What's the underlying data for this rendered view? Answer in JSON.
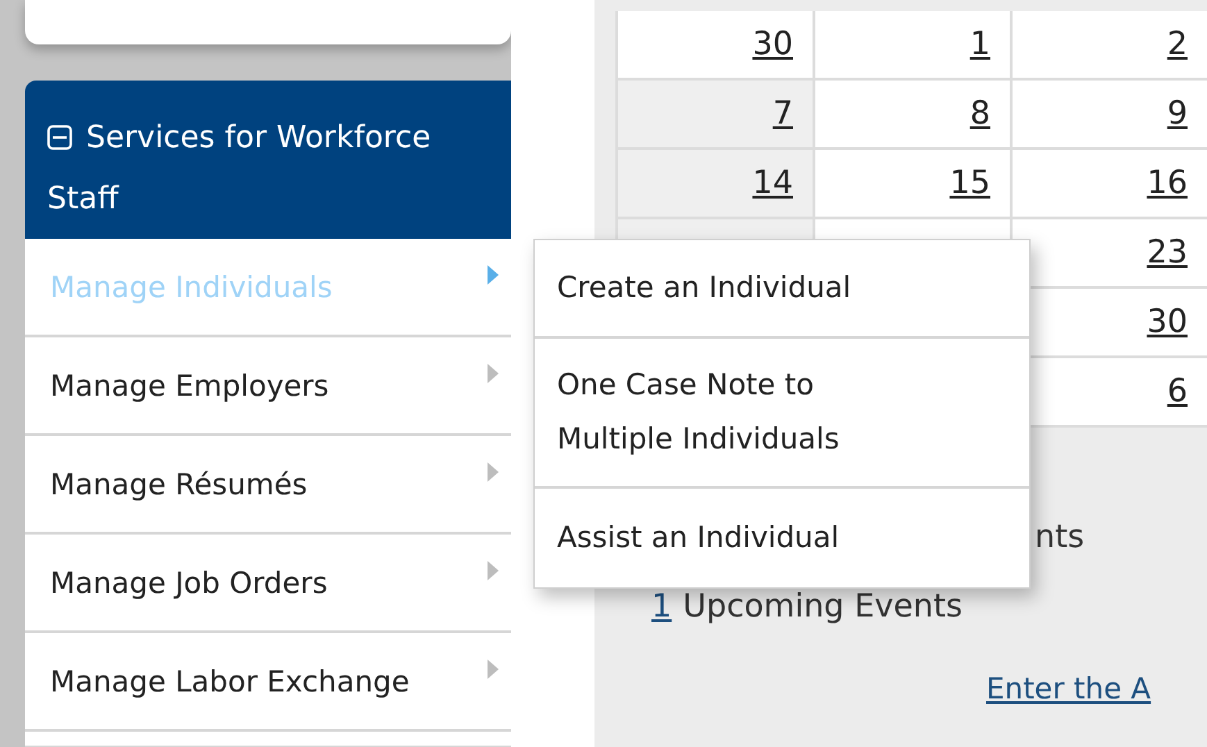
{
  "sidebar": {
    "header": {
      "label": "Services for Workforce Staff",
      "expanded": true
    },
    "items": [
      {
        "label": "Manage Individuals",
        "selected": true
      },
      {
        "label": "Manage Employers",
        "selected": false
      },
      {
        "label": "Manage Résumés",
        "selected": false
      },
      {
        "label": "Manage Job Orders",
        "selected": false
      },
      {
        "label": "Manage Labor Exchange",
        "selected": false
      }
    ]
  },
  "submenu": {
    "items": [
      "Create an Individual",
      "One Case Note to Multiple Individuals",
      "Assist an Individual"
    ]
  },
  "calendar": {
    "rows": [
      [
        "30",
        "1",
        "2"
      ],
      [
        "7",
        "8",
        "9"
      ],
      [
        "14",
        "15",
        "16"
      ],
      [
        "",
        "",
        "23"
      ],
      [
        "",
        "",
        "30"
      ],
      [
        "",
        "",
        "6"
      ]
    ]
  },
  "events": {
    "past_label": "nts",
    "upcoming_count": "1",
    "upcoming_label": "Upcoming Events",
    "enter_link": "Enter the A"
  }
}
